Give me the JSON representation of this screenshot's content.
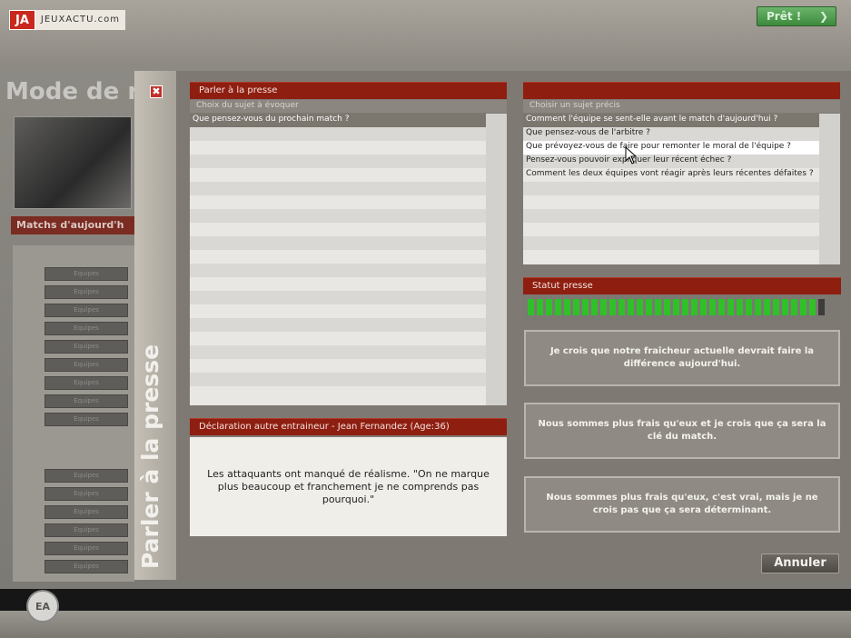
{
  "site": {
    "logo_ja": "JA",
    "logo_text": "JEUXACTU.com"
  },
  "top": {
    "pret_label": "Prêt !",
    "pret_arrow": "❯"
  },
  "background": {
    "mode_title": "Mode de r",
    "matchs_label": "Matchs d'aujourd'h",
    "list_btn_label": "Equipes"
  },
  "modal": {
    "close_label": "✖",
    "side_title": "Parler à la presse",
    "left_panel": {
      "header": "Parler à la presse",
      "subheader": "Choix du sujet à évoquer",
      "items": [
        "Que pensez-vous du prochain match ?"
      ]
    },
    "right_panel": {
      "header": "",
      "subheader": "Choisir un sujet précis",
      "items": [
        "Comment l'équipe se sent-elle avant le match d'aujourd'hui ?",
        "Que pensez-vous de l'arbitre ?",
        "Que prévoyez-vous de faire pour remonter le moral de l'équipe ?",
        "Pensez-vous pouvoir expliquer leur récent échec ?",
        "Comment les deux équipes vont réagir après leurs récentes défaites ?"
      ]
    },
    "statut": {
      "header": "Statut presse",
      "level": 0.97,
      "segments_total": 33,
      "segments_filled": 32
    },
    "declaration": {
      "header": "Déclaration autre entraineur - Jean Fernandez (Age:36)",
      "text": "Les attaquants ont manqué de réalisme. \"On ne marque plus beaucoup et franchement je ne comprends pas pourquoi.\""
    },
    "answers": [
      "Je crois que notre fraîcheur actuelle devrait faire la différence aujourd'hui.",
      "Nous sommes plus frais qu'eux et je crois que ça sera la clé du match.",
      "Nous sommes plus frais qu'eux, c'est vrai, mais je ne crois pas que ça sera déterminant."
    ],
    "cancel_label": "Annuler"
  },
  "colors": {
    "accent": "#8e1e10",
    "bar_fill": "#2fc128",
    "bar_empty": "#3c3c3c"
  },
  "icons": {
    "close": "close-icon",
    "pointer": "mouse-cursor-icon"
  }
}
